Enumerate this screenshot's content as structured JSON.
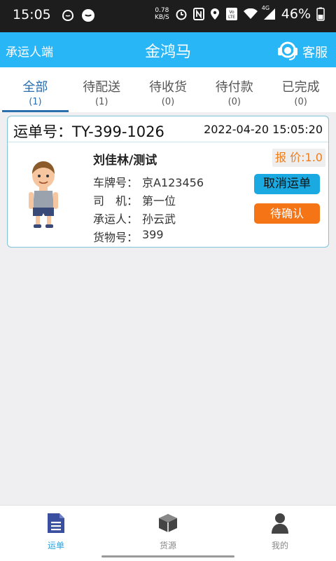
{
  "status_bar": {
    "time": "15:05",
    "net_speed_value": "0.78",
    "net_speed_unit": "KB/S",
    "signal_label": "4G",
    "battery": "46%",
    "icons": [
      "qq-icon",
      "chat-icon",
      "speed-icon",
      "alarm-icon",
      "nfc-icon",
      "location-icon",
      "volte-icon",
      "wifi-icon",
      "signal-icon",
      "battery-icon"
    ]
  },
  "header": {
    "left_label": "承运人端",
    "title": "金鸿马",
    "service_label": "客服",
    "service_icon": "headset-icon",
    "color": "#29b6f6"
  },
  "tabs": [
    {
      "label": "全部",
      "count": "(1)",
      "active": true
    },
    {
      "label": "待配送",
      "count": "(1)",
      "active": false
    },
    {
      "label": "待收货",
      "count": "(0)",
      "active": false
    },
    {
      "label": "待付款",
      "count": "(0)",
      "active": false
    },
    {
      "label": "已完成",
      "count": "(0)",
      "active": false
    }
  ],
  "order": {
    "order_no": "运单号：TY-399-1026",
    "time": "2022-04-20 15:05:20",
    "name": "刘佳林/测试",
    "plate_label": "车牌号：",
    "plate": "京A123456",
    "driver_label": "司　机：",
    "driver": "第一位",
    "carrier_label": "承运人：",
    "carrier": "孙云武",
    "cargo_label": "货物号：",
    "cargo": "399",
    "price": "报 价:1.0",
    "cancel_button": "取消运单",
    "confirm_button": "待确认",
    "avatar_icon": "person-avatar-icon"
  },
  "bottom_nav": [
    {
      "label": "运单",
      "icon": "document-icon",
      "active": true
    },
    {
      "label": "货源",
      "icon": "box-icon",
      "active": false
    },
    {
      "label": "我的",
      "icon": "user-icon",
      "active": false
    }
  ],
  "colors": {
    "accent": "#29b6f6",
    "tab_active": "#2a6fb0",
    "cancel_btn": "#1ba9e1",
    "confirm_btn": "#f57416",
    "price_text": "#f07c1c"
  }
}
